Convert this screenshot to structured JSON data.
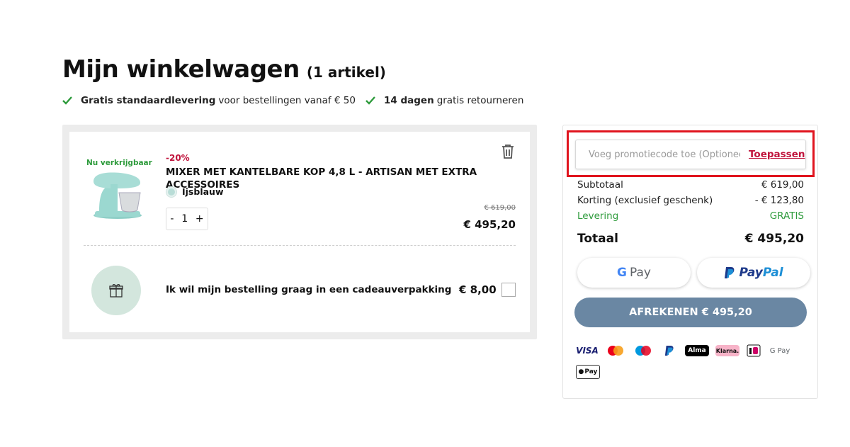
{
  "header": {
    "title": "Mijn winkelwagen",
    "count": "(1 artikel)"
  },
  "perks": [
    {
      "bold": "Gratis standaardlevering",
      "text": "voor bestellingen vanaf € 50"
    },
    {
      "bold": "14 dagen",
      "text": "gratis retourneren"
    }
  ],
  "cart": {
    "item": {
      "availability": "Nu verkrijgbaar",
      "discount": "-20%",
      "name": "MIXER MET KANTELBARE KOP 4,8 L - ARTISAN MET EXTRA ACCESSOIRES",
      "color": "Ijsblauw",
      "color_hex": "#b9ddd7",
      "qty_minus": "-",
      "qty": "1",
      "qty_plus": "+",
      "old_price": "€ 619,00",
      "price": "€ 495,20"
    },
    "gift": {
      "label": "Ik wil mijn bestelling graag in een cadeauverpakking",
      "price": "€ 8,00"
    }
  },
  "summary": {
    "promo_placeholder": "Voeg promotiecode toe (Optioneel)",
    "promo_apply": "Toepassen",
    "lines": [
      {
        "label": "Subtotaal",
        "value": "€ 619,00"
      },
      {
        "label": "Korting (exclusief geschenk)",
        "value": "- € 123,80"
      },
      {
        "label": "Levering",
        "value": "GRATIS"
      }
    ],
    "total_label": "Totaal",
    "total_value": "€ 495,20",
    "gpay_g": "G",
    "gpay_label": "Pay",
    "paypal_1": "Pay",
    "paypal_2": "Pal",
    "checkout_label": "AFREKENEN € 495,20",
    "payment_methods": {
      "visa": "VISA",
      "alma": "Alma",
      "klarna": "Klarna.",
      "gpay": "G Pay",
      "applepay": "Pay"
    }
  },
  "colors": {
    "accent_red": "#c0143c",
    "green": "#2e9b3c",
    "checkout_bg": "#6a87a3",
    "highlight": "#e0141e"
  }
}
